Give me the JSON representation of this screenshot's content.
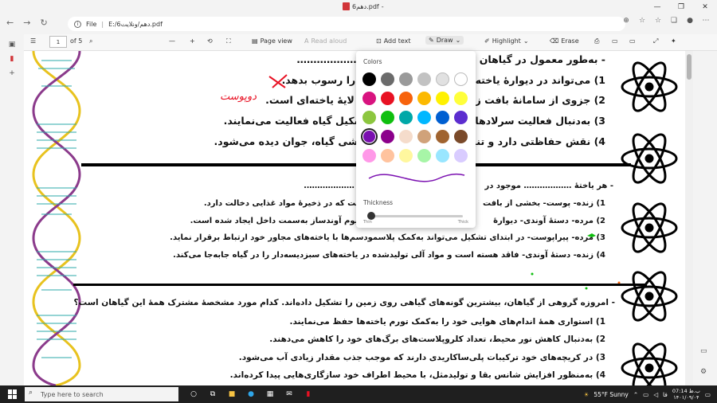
{
  "window": {
    "title": "6دهم.pdf",
    "title_suffix": "-"
  },
  "address": {
    "scheme": "File",
    "path": "E:/6دهم/ونلایت.pdf"
  },
  "pdf_toolbar": {
    "page": "1",
    "of": "of 5",
    "minus": "—",
    "plus": "+",
    "page_view": "Page view",
    "read_aloud": "Read aloud",
    "add_text": "Add text",
    "draw": "Draw",
    "highlight": "Highlight",
    "erase": "Erase"
  },
  "draw_popup": {
    "colors_label": "Colors",
    "thickness_label": "Thickness",
    "thin": "Thin",
    "thick": "Thick",
    "selected_color": "#7a0fb0",
    "swatches": [
      "#000000",
      "#6b6b6b",
      "#9a9a9a",
      "#c2c2c2",
      "#e1e1e1",
      "#ffffff",
      "#d8137f",
      "#e81123",
      "#f7630c",
      "#fcb900",
      "#fff100",
      "#ffff3b",
      "#8cc63f",
      "#0fbf0f",
      "#00a8a8",
      "#00b7ff",
      "#005fd1",
      "#5c2dcf",
      "#7a0fb0",
      "#8b008b",
      "#f5dccb",
      "#d0a27a",
      "#a0632f",
      "#7a4a2a",
      "#ff99e8",
      "#ffc39e",
      "#fff79e",
      "#a7f5a7",
      "#99e6ff",
      "#d9ccff"
    ]
  },
  "doc": {
    "q1_header": "- به‌طور معمول در گیاهان",
    "q1_dots": "…………………",
    "q1_a": "1) می‌تواند در دیوارهٔ یاخته‌",
    "q1_a2": "ی را رسوب بدهد.",
    "q1_b": "2) جزوی از سامانهٔ بافت زمین",
    "q1_b2": "ک لایهٔ یاخته‌ای است.",
    "q1_c": "3) به‌دنبال فعالیت سرلادهای",
    "q1_c2": "تشکیل گیاه فعالیت می‌نمایند.",
    "q1_d": "4) نقش حفاظتی دارد و تنها",
    "q1_d2": "ششی گیاه، جوان دیده می‌شود.",
    "handwriting": "دوپوست",
    "q2_header": "- هر یاختهٔ ……………… موجود در",
    "q2_header2": "تم ……………….",
    "q2_a": "1) زنده- پوست- بخشی از بافت",
    "q2_a2": "است که در ذخیرهٔ مواد غذایی دخالت دارد.",
    "q2_b": "2) مرده- دستهٔ آوندی- دیوارهٔ",
    "q2_b2": "مبیوم آوندساز به‌سمت داخل ایجاد شده است.",
    "q2_c": "3) مرده- پیراپوست- در ابتدای تشکیل می‌تواند به‌کمک پلاسمودسم‌ها با یاخته‌های مجاور خود ارتباط برقرار نماید.",
    "q2_d": "4) زنده- دستهٔ آوندی- فاقد هسته است و مواد آلی تولیدشده در یاخته‌های سبزدیسه‌دار را در گیاه جابه‌جا می‌کند.",
    "q3_header": "- امروزه گروهی از گیاهان، بیشترین گونه‌های گیاهی روی زمین را تشکیل داده‌اند. کدام مورد مشخصهٔ مشترک همهٔ این گیاهان است؟",
    "q3_a": "1) استواری همهٔ اندام‌های هوایی خود را به‌کمک تورم یاخته‌ها حفظ می‌نمایند.",
    "q3_b": "2) به‌دنبال کاهش نور محیط، تعداد کلروپلاست‌های برگ‌های خود را کاهش می‌دهند.",
    "q3_c": "3) در کریچه‌های خود ترکیبات پلی‌ساکاریدی دارند که موجب جذب مقدار زیادی آب می‌شود.",
    "q3_d": "4) به‌منظور افزایش شانس بقا و تولیدمثل، با محیط اطراف خود سازگاری‌هایی پیدا کرده‌اند."
  },
  "taskbar": {
    "search_placeholder": "Type here to search",
    "weather": "55°F Sunny",
    "lang": "فا",
    "time": "07:14 ب.ظ",
    "date": "۱۴۰۱/۰۹/۰۴"
  }
}
